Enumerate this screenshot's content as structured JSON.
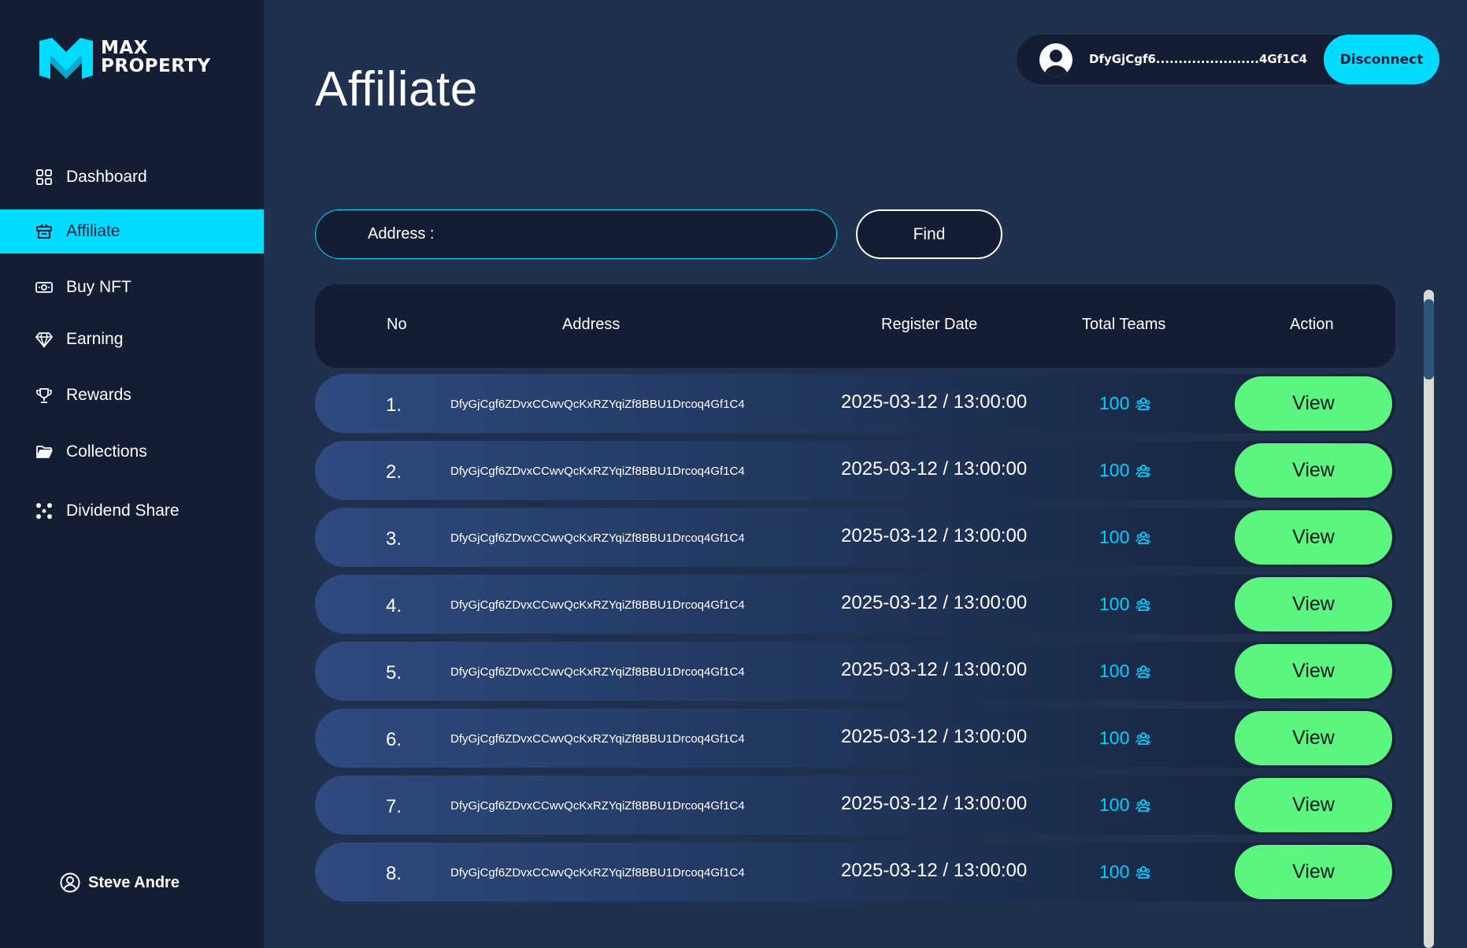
{
  "brand": {
    "line1": "MAX",
    "line2": "PROPERTY",
    "accent": "#00dbff"
  },
  "sidebar": {
    "items": [
      {
        "label": "Dashboard",
        "icon": "grid-icon",
        "active": false
      },
      {
        "label": "Affiliate",
        "icon": "affiliate-icon",
        "active": true
      },
      {
        "label": "Buy NFT",
        "icon": "money-icon",
        "active": false
      },
      {
        "label": "Earning",
        "icon": "diamond-icon",
        "active": false
      },
      {
        "label": "Rewards",
        "icon": "trophy-icon",
        "active": false
      },
      {
        "label": "Collections",
        "icon": "folder-icon",
        "active": false
      },
      {
        "label": "Dividend Share",
        "icon": "share-icon",
        "active": false
      }
    ],
    "user_name": "Steve Andre"
  },
  "header": {
    "title": "Affiliate",
    "wallet_address": "DfyGjCgf6.......................4Gf1C4",
    "disconnect_label": "Disconnect"
  },
  "search": {
    "label": "Address :",
    "value": "",
    "find_label": "Find"
  },
  "table": {
    "columns": [
      "No",
      "Address",
      "Register Date",
      "Total Teams",
      "Action"
    ],
    "rows": [
      {
        "no": "1.",
        "address": "DfyGjCgf6ZDvxCCwvQcKxRZYqiZf8BBU1Drcoq4Gf1C4",
        "date": "2025-03-12 / 13:00:00",
        "teams": "100",
        "action": "View"
      },
      {
        "no": "2.",
        "address": "DfyGjCgf6ZDvxCCwvQcKxRZYqiZf8BBU1Drcoq4Gf1C4",
        "date": "2025-03-12 / 13:00:00",
        "teams": "100",
        "action": "View"
      },
      {
        "no": "3.",
        "address": "DfyGjCgf6ZDvxCCwvQcKxRZYqiZf8BBU1Drcoq4Gf1C4",
        "date": "2025-03-12 / 13:00:00",
        "teams": "100",
        "action": "View"
      },
      {
        "no": "4.",
        "address": "DfyGjCgf6ZDvxCCwvQcKxRZYqiZf8BBU1Drcoq4Gf1C4",
        "date": "2025-03-12 / 13:00:00",
        "teams": "100",
        "action": "View"
      },
      {
        "no": "5.",
        "address": "DfyGjCgf6ZDvxCCwvQcKxRZYqiZf8BBU1Drcoq4Gf1C4",
        "date": "2025-03-12 / 13:00:00",
        "teams": "100",
        "action": "View"
      },
      {
        "no": "6.",
        "address": "DfyGjCgf6ZDvxCCwvQcKxRZYqiZf8BBU1Drcoq4Gf1C4",
        "date": "2025-03-12 / 13:00:00",
        "teams": "100",
        "action": "View"
      },
      {
        "no": "7.",
        "address": "DfyGjCgf6ZDvxCCwvQcKxRZYqiZf8BBU1Drcoq4Gf1C4",
        "date": "2025-03-12 / 13:00:00",
        "teams": "100",
        "action": "View"
      },
      {
        "no": "8.",
        "address": "DfyGjCgf6ZDvxCCwvQcKxRZYqiZf8BBU1Drcoq4Gf1C4",
        "date": "2025-03-12 / 13:00:00",
        "teams": "100",
        "action": "View"
      }
    ]
  },
  "colors": {
    "view_button": "#5cf57f",
    "teams_text": "#00cfff",
    "sidebar_bg": "#131d33",
    "page_bg": "#20304f"
  }
}
